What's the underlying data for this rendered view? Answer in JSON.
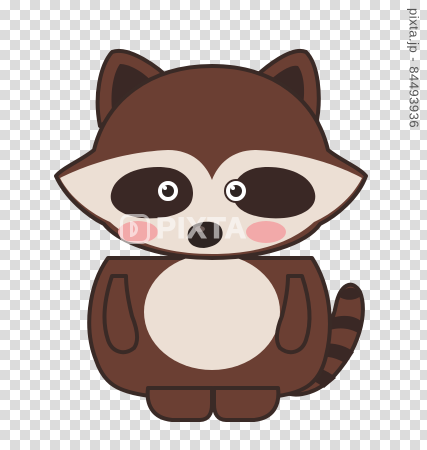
{
  "image": {
    "subject": "raccoon-dog",
    "colors": {
      "outline": "#3a2a26",
      "fur_brown": "#6b3f33",
      "face_cream": "#ecdfd4",
      "eye_mask": "#3a2825",
      "eye_white": "#ffffff",
      "cheek_pink": "#f2a9a9",
      "nose": "#2e2422",
      "ear_inner": "#3a2825",
      "tail_ring": "#3a2825",
      "checker_light": "#ffffff",
      "checker_dark": "#dcdcdc"
    }
  },
  "watermark": {
    "text": "PIXTA"
  },
  "side_id": {
    "text": "pixta.jp - 84493936"
  }
}
